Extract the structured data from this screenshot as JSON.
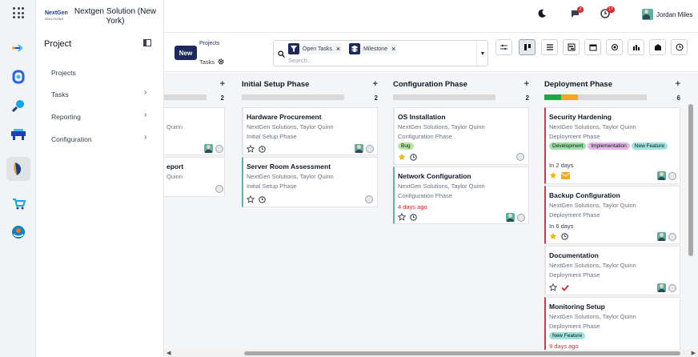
{
  "rail": {
    "apps": [
      "apps-icon",
      "discuss-app-icon",
      "project-app-icon",
      "search-app-icon",
      "pos-app-icon",
      "active-app-icon",
      "shop-app-icon",
      "community-app-icon"
    ]
  },
  "company": {
    "logo_text": "NextGen",
    "logo_sub": "SOLUTIONS",
    "name": "Nextgen Solution (New York)"
  },
  "sidebar": {
    "title": "Project",
    "items": [
      {
        "label": "Projects",
        "has_arrow": false
      },
      {
        "label": "Tasks",
        "has_arrow": true
      },
      {
        "label": "Reporting",
        "has_arrow": true
      },
      {
        "label": "Configuration",
        "has_arrow": true
      }
    ]
  },
  "topbar": {
    "chat_count": "2",
    "activity_count": "17",
    "user_name": "Jordan Miles"
  },
  "control": {
    "new_label": "New",
    "breadcrumb_parent": "Projects",
    "breadcrumb_current": "Tasks",
    "facets": [
      "Open Tasks",
      "Milestone"
    ],
    "search_placeholder": "Search..."
  },
  "columns": [
    {
      "name": "",
      "count": "2",
      "cards": [
        {
          "title": "",
          "subtitle": "Quinn",
          "stage": ""
        },
        {
          "title": "eport",
          "subtitle": "Quinn",
          "stage": ""
        }
      ]
    },
    {
      "name": "Initial Setup Phase",
      "count": "2",
      "cards": [
        {
          "title": "Hardware Procurement",
          "subtitle": "NextGen Solutions, Taylor Quinn",
          "stage": "Initial Setup Phase"
        },
        {
          "title": "Server Room Assessment",
          "subtitle": "NextGen Solutions, Taylor Quinn",
          "stage": "Initial Setup Phase"
        }
      ]
    },
    {
      "name": "Configuration Phase",
      "count": "2",
      "cards": [
        {
          "title": "OS Installation",
          "subtitle": "NextGen Solutions, Taylor Quinn",
          "stage": "Configuration Phase",
          "tags": [
            "Bug"
          ]
        },
        {
          "title": "Network Configuration",
          "subtitle": "NextGen Solutions, Taylor Quinn",
          "stage": "Configuration Phase",
          "due": "4 days ago"
        }
      ]
    },
    {
      "name": "Deployment Phase",
      "count": "6",
      "cards": [
        {
          "title": "Security Hardening",
          "subtitle": "NextGen Solutions, Taylor Quinn",
          "stage": "Deployment Phase",
          "tags": [
            "Development",
            "Implementation",
            "New Feature"
          ],
          "due": "In 2 days"
        },
        {
          "title": "Backup Configuration",
          "subtitle": "NextGen Solutions, Taylor Quinn",
          "stage": "Deployment Phase",
          "due": "In 6 days"
        },
        {
          "title": "Documentation",
          "subtitle": "NextGen Solutions, Taylor Quinn",
          "stage": "Deployment Phase"
        },
        {
          "title": "Monitoring Setup",
          "subtitle": "NextGen Solutions, Taylor Quinn",
          "stage": "Deployment Phase",
          "tags": [
            "New Feature"
          ],
          "due": "9 days ago"
        }
      ]
    }
  ],
  "colors": {
    "brand": "#1e2a5e",
    "overdue": "#dc2626",
    "star": "#f5b301",
    "bug": "#b7e4a7",
    "development": "#9be0a8",
    "implementation": "#e2b6e6",
    "new_feature": "#9de3dd"
  }
}
